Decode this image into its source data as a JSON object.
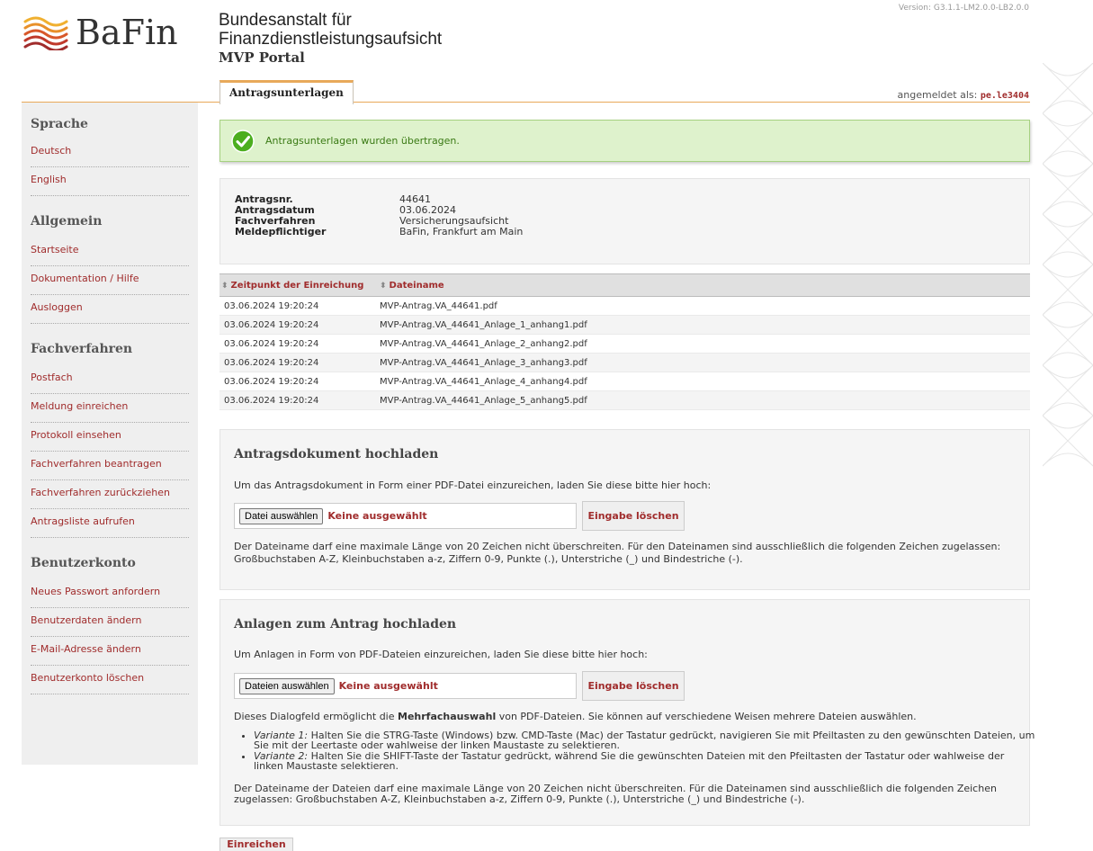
{
  "version": "Version: G3.1.1-LM2.0.0-LB2.0.0",
  "brand": {
    "logo_text": "BaFin",
    "line1": "Bundesanstalt für",
    "line2": "Finanzdienstleistungsaufsicht",
    "portal": "MVP Portal"
  },
  "tab": {
    "label": "Antragsunterlagen"
  },
  "login": {
    "prefix": "angemeldet als:",
    "user": "pe.le3404"
  },
  "sidebar": {
    "groups": [
      {
        "title": "Sprache",
        "items": [
          "Deutsch",
          "English"
        ]
      },
      {
        "title": "Allgemein",
        "items": [
          "Startseite",
          "Dokumentation / Hilfe",
          "Ausloggen"
        ]
      },
      {
        "title": "Fachverfahren",
        "items": [
          "Postfach",
          "Meldung einreichen",
          "Protokoll einsehen",
          "Fachverfahren beantragen",
          "Fachverfahren zurückziehen",
          "Antragsliste aufrufen"
        ]
      },
      {
        "title": "Benutzerkonto",
        "items": [
          "Neues Passwort anfordern",
          "Benutzerdaten ändern",
          "E-Mail-Adresse ändern",
          "Benutzerkonto löschen"
        ]
      }
    ]
  },
  "success_message": "Antragsunterlagen wurden übertragen.",
  "info": {
    "rows": [
      {
        "label": "Antragsnr.",
        "value": "44641"
      },
      {
        "label": "Antragsdatum",
        "value": "03.06.2024"
      },
      {
        "label": "Fachverfahren",
        "value": "Versicherungsaufsicht"
      },
      {
        "label": "Meldepflichtiger",
        "value": "BaFin, Frankfurt am Main"
      }
    ]
  },
  "files": {
    "headers": [
      "Zeitpunkt der Einreichung",
      "Dateiname"
    ],
    "rows": [
      [
        "03.06.2024 19:20:24",
        "MVP-Antrag.VA_44641.pdf"
      ],
      [
        "03.06.2024 19:20:24",
        "MVP-Antrag.VA_44641_Anlage_1_anhang1.pdf"
      ],
      [
        "03.06.2024 19:20:24",
        "MVP-Antrag.VA_44641_Anlage_2_anhang2.pdf"
      ],
      [
        "03.06.2024 19:20:24",
        "MVP-Antrag.VA_44641_Anlage_3_anhang3.pdf"
      ],
      [
        "03.06.2024 19:20:24",
        "MVP-Antrag.VA_44641_Anlage_4_anhang4.pdf"
      ],
      [
        "03.06.2024 19:20:24",
        "MVP-Antrag.VA_44641_Anlage_5_anhang5.pdf"
      ]
    ]
  },
  "upload_main": {
    "title": "Antragsdokument hochladen",
    "intro": "Um das Antragsdokument in Form einer PDF-Datei einzureichen, laden Sie diese bitte hier hoch:",
    "choose_label": "Datei auswählen",
    "status": "Keine ausgewählt",
    "clear_label": "Eingabe löschen",
    "note1": "Der Dateiname darf eine maximale Länge von 20 Zeichen nicht überschreiten. Für den Dateinamen sind ausschließlich die folgenden Zeichen zugelassen:",
    "note2": "Großbuchstaben A-Z, Kleinbuchstaben a-z, Ziffern 0-9, Punkte (.), Unterstriche (_) und Bindestriche (-)."
  },
  "upload_attach": {
    "title": "Anlagen zum Antrag hochladen",
    "intro": "Um Anlagen in Form von PDF-Dateien einzureichen, laden Sie diese bitte hier hoch:",
    "choose_label": "Dateien auswählen",
    "status": "Keine ausgewählt",
    "clear_label": "Eingabe löschen",
    "multi_pre": "Dieses Dialogfeld ermöglicht die ",
    "multi_bold": "Mehrfachauswahl",
    "multi_post": " von PDF-Dateien. Sie können auf verschiedene Weisen mehrere Dateien auswählen.",
    "variant1_label": "Variante 1:",
    "variant1_text": " Halten Sie die STRG-Taste (Windows) bzw. CMD-Taste (Mac) der Tastatur gedrückt, navigieren Sie mit Pfeiltasten zu den gewünschten Dateien, um Sie mit der Leertaste oder wahlweise der linken Maustaste zu selektieren.",
    "variant2_label": "Variante 2:",
    "variant2_text": " Halten Sie die SHIFT-Taste der Tastatur gedrückt, während Sie die gewünschten Dateien mit den Pfeiltasten der Tastatur oder wahlweise der linken Maustaste selektieren.",
    "note": "Der Dateiname der Dateien darf eine maximale Länge von 20 Zeichen nicht überschreiten. Für die Dateinamen sind ausschließlich die folgenden Zeichen zugelassen: Großbuchstaben A-Z, Kleinbuchstaben a-z, Ziffern 0-9, Punkte (.), Unterstriche (_) und Bindestriche (-)."
  },
  "submit_label": "Einreichen"
}
